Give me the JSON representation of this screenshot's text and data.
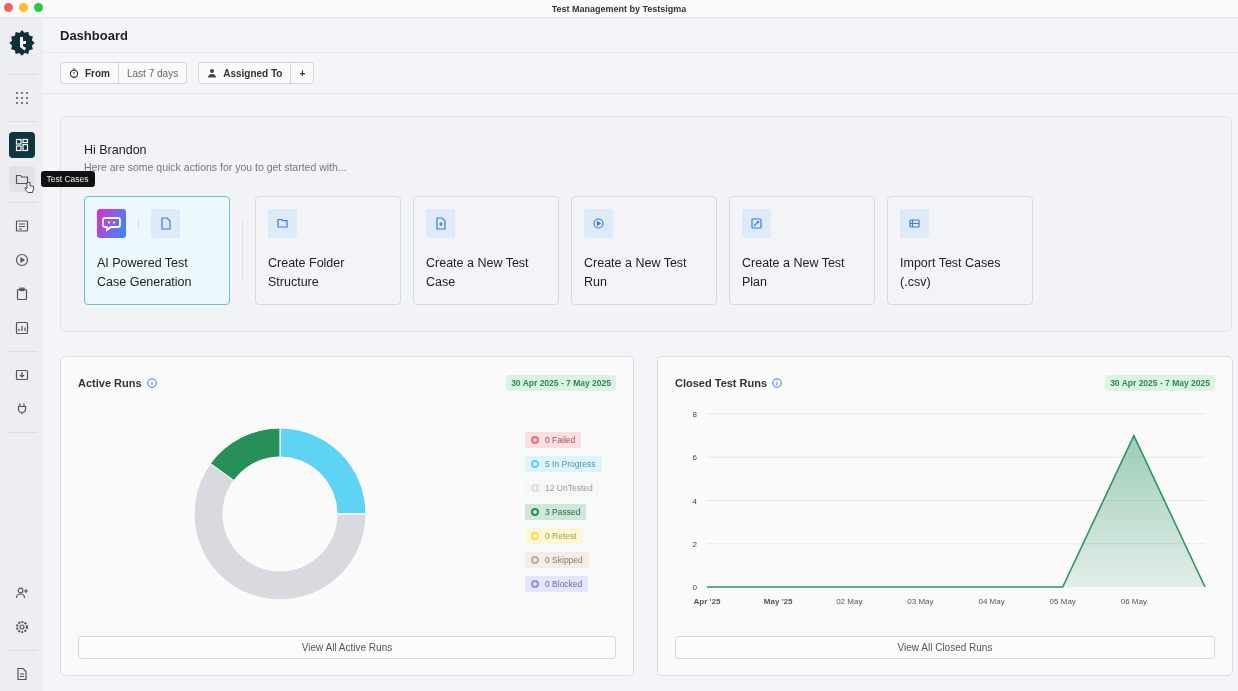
{
  "window": {
    "title": "Test Management by Testsigma"
  },
  "sidebar": {
    "items": [
      {
        "kind": "apps",
        "selected": false,
        "hovered": false
      },
      {
        "kind": "dashboard",
        "selected": true,
        "hovered": false
      },
      {
        "kind": "folder",
        "selected": false,
        "hovered": true,
        "tooltip": "Test Cases"
      },
      {
        "kind": "list",
        "selected": false,
        "hovered": false
      },
      {
        "kind": "play",
        "selected": false,
        "hovered": false
      },
      {
        "kind": "clipboard",
        "selected": false,
        "hovered": false
      },
      {
        "kind": "report",
        "selected": false,
        "hovered": false
      },
      {
        "kind": "download",
        "selected": false,
        "hovered": false
      },
      {
        "kind": "plug",
        "selected": false,
        "hovered": false
      },
      {
        "kind": "user-add",
        "selected": false,
        "hovered": false
      },
      {
        "kind": "settings",
        "selected": false,
        "hovered": false
      },
      {
        "kind": "document",
        "selected": false,
        "hovered": false
      }
    ]
  },
  "page": {
    "title": "Dashboard"
  },
  "filters": [
    {
      "label": "From",
      "value": "Last 7 days"
    },
    {
      "label": "Assigned To",
      "value": "+"
    }
  ],
  "welcome": {
    "greeting": "Hi Brandon",
    "subtitle": "Here are some quick actions for you to get started with..."
  },
  "quick_actions": [
    {
      "label": "AI Powered Test Case Generation",
      "selected": true
    },
    {
      "label": "Create Folder Structure",
      "selected": false
    },
    {
      "label": "Create a New Test Case",
      "selected": false
    },
    {
      "label": "Create a New Test Run",
      "selected": false
    },
    {
      "label": "Create a New Test Plan",
      "selected": false
    },
    {
      "label": "Import Test Cases (.csv)",
      "selected": false
    }
  ],
  "active_runs": {
    "title": "Active Runs",
    "date_range": "30 Apr 2025 - 7 May 2025",
    "chart_data": {
      "type": "donut",
      "values": [
        0,
        25,
        60,
        15,
        0,
        0,
        0
      ]
    },
    "legend": [
      {
        "label": "0 Failed",
        "color": "#e5697a"
      },
      {
        "label": "5 In Progress",
        "color": "#5fd3f3"
      },
      {
        "label": "12 UnTested",
        "color": "#d9dadf"
      },
      {
        "label": "3 Passed",
        "color": "#27905a"
      },
      {
        "label": "0 Retest",
        "color": "#f2e14a"
      },
      {
        "label": "0 Skipped",
        "color": "#c9a99a"
      },
      {
        "label": "0 Blocked",
        "color": "#8c8fe8"
      }
    ],
    "button": "View All Active Runs"
  },
  "closed_runs": {
    "title": "Closed Test Runs",
    "date_range": "30 Apr 2025 - 7 May 2025",
    "chart_data": {
      "type": "area",
      "categories": [
        "Apr '25",
        "May '25",
        "02 May",
        "03 May",
        "04 May",
        "05 May",
        "06 May",
        null
      ],
      "series": [
        {
          "color": "#2e9466",
          "values": [
            0,
            0,
            0,
            0,
            0,
            0,
            7,
            0
          ]
        }
      ],
      "ylim": [
        0,
        8
      ],
      "yticks": [
        0,
        2,
        4,
        6,
        8
      ],
      "grid": true
    },
    "button": "View All Closed Runs"
  }
}
